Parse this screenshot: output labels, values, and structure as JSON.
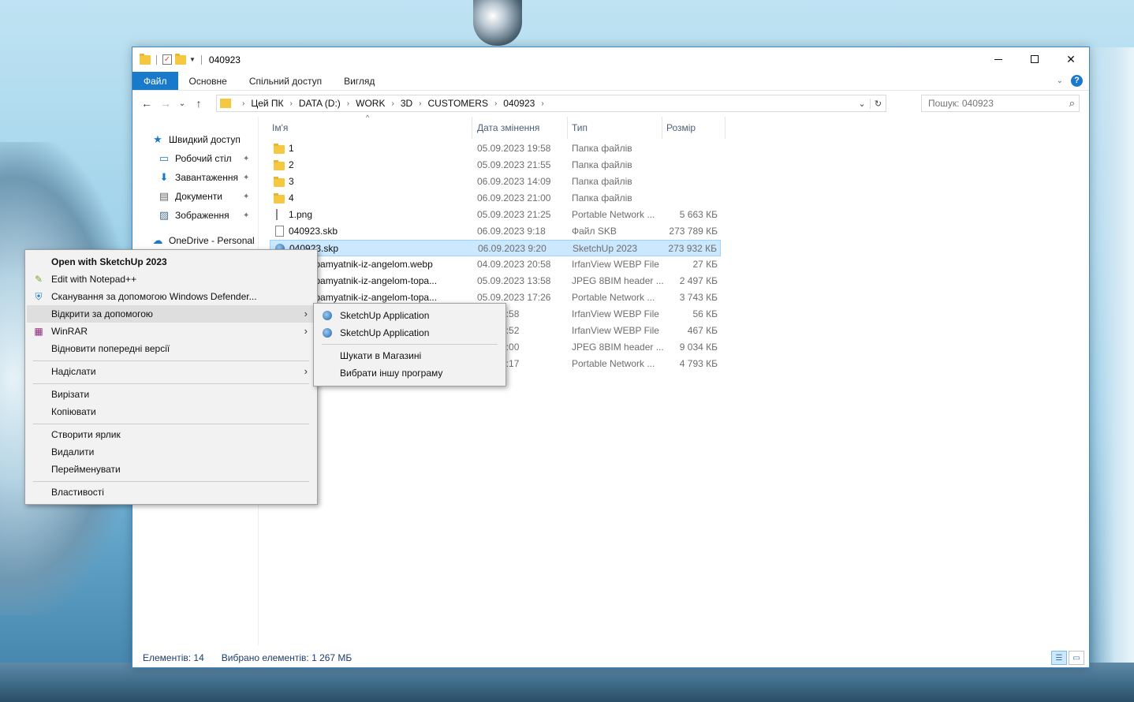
{
  "window": {
    "title": "040923",
    "qat_separator": "|",
    "controls": {
      "minimize": "–",
      "maximize": "☐",
      "close": "✕"
    }
  },
  "ribbon": {
    "tabs": [
      "Файл",
      "Основне",
      "Спільний доступ",
      "Вигляд"
    ],
    "expand_glyph": "⌄",
    "help_glyph": "?"
  },
  "nav": {
    "back": "←",
    "forward": "→",
    "recent": "⌄",
    "up": "↑"
  },
  "address": {
    "crumbs": [
      "Цей ПК",
      "DATA (D:)",
      "WORK",
      "3D",
      "CUSTOMERS",
      "040923"
    ],
    "separator": "›",
    "dropdown_glyph": "⌄",
    "refresh_glyph": "↻"
  },
  "search": {
    "placeholder": "Пошук: 040923",
    "icon_glyph": "⌕"
  },
  "navpane": {
    "items": [
      {
        "label": "Швидкий доступ",
        "icon": "star-icon",
        "glyph": "★",
        "color": "#1979ca"
      },
      {
        "label": "Робочий стіл",
        "icon": "desktop-icon",
        "glyph": "▭",
        "color": "#1979ca",
        "pinned": true
      },
      {
        "label": "Завантаження",
        "icon": "download-icon",
        "glyph": "⬇",
        "color": "#1979ca",
        "pinned": true
      },
      {
        "label": "Документи",
        "icon": "documents-icon",
        "glyph": "▤",
        "color": "#666666",
        "pinned": true
      },
      {
        "label": "Зображення",
        "icon": "pictures-icon",
        "glyph": "▨",
        "color": "#4a6d8c",
        "pinned": true
      },
      {
        "label": "OneDrive - Personal",
        "icon": "onedrive-icon",
        "glyph": "☁",
        "color": "#1979ca"
      }
    ],
    "pin_glyph": "📌"
  },
  "columns": {
    "name": "Ім'я",
    "date": "Дата змінення",
    "type": "Тип",
    "size": "Розмір",
    "sort_glyph": "^"
  },
  "files": [
    {
      "name": "1",
      "date": "05.09.2023 19:58",
      "type": "Папка файлів",
      "size": "",
      "icon": "folder"
    },
    {
      "name": "2",
      "date": "05.09.2023 21:55",
      "type": "Папка файлів",
      "size": "",
      "icon": "folder"
    },
    {
      "name": "3",
      "date": "06.09.2023 14:09",
      "type": "Папка файлів",
      "size": "",
      "icon": "folder"
    },
    {
      "name": "4",
      "date": "06.09.2023 21:00",
      "type": "Папка файлів",
      "size": "",
      "icon": "folder"
    },
    {
      "name": "1.png",
      "date": "05.09.2023 21:25",
      "type": "Portable Network ...",
      "size": "5 663 КБ",
      "icon": "png"
    },
    {
      "name": "040923.skb",
      "date": "06.09.2023 9:18",
      "type": "Файл SKB",
      "size": "273 789 КБ",
      "icon": "file"
    },
    {
      "name": "040923.skp",
      "date": "06.09.2023 9:20",
      "type": "SketchUp 2023",
      "size": "273 932 КБ",
      "icon": "skp",
      "selected": true
    },
    {
      "name": "5171_pamyatnik-iz-angelom.webp",
      "date": "04.09.2023 20:58",
      "type": "IrfanView WEBP File",
      "size": "27 КБ",
      "icon": "file"
    },
    {
      "name": "5171_pamyatnik-iz-angelom-topa...",
      "date": "05.09.2023 13:58",
      "type": "JPEG 8BIM header ...",
      "size": "2 497 КБ",
      "icon": "file"
    },
    {
      "name": "5171_pamyatnik-iz-angelom-topa...",
      "date": "05.09.2023 17:26",
      "type": "Portable Network ...",
      "size": "3 743 КБ",
      "icon": "file"
    },
    {
      "name": "",
      "date": "023 20:58",
      "type": "IrfanView WEBP File",
      "size": "56 КБ",
      "icon": "none"
    },
    {
      "name": "",
      "date": "023 13:52",
      "type": "IrfanView WEBP File",
      "size": "467 КБ",
      "icon": "none"
    },
    {
      "name": "",
      "date": "023 14:00",
      "type": "JPEG 8BIM header ...",
      "size": "9 034 КБ",
      "icon": "none"
    },
    {
      "name": "",
      "date": "023 17:17",
      "type": "Portable Network ...",
      "size": "4 793 КБ",
      "icon": "none"
    }
  ],
  "status": {
    "count": "Елементів: 14",
    "selected": "Вибрано елементів: 1  267 МБ"
  },
  "context_menu": {
    "items": [
      {
        "label": "Open with SketchUp 2023",
        "bold": true
      },
      {
        "label": "Edit with Notepad++",
        "icon": "notepadpp-icon",
        "glyph": "✎"
      },
      {
        "label": "Сканування за допомогою Windows Defender...",
        "icon": "defender-icon",
        "glyph": "⛨"
      },
      {
        "label": "Відкрити за допомогою",
        "submenu": true,
        "hover": true
      },
      {
        "label": "WinRAR",
        "icon": "winrar-icon",
        "glyph": "▦",
        "submenu": true
      },
      {
        "label": "Відновити попередні версії"
      },
      {
        "label": "Надіслати",
        "submenu": true
      },
      {
        "label": "Вирізати"
      },
      {
        "label": "Копіювати"
      },
      {
        "label": "Створити ярлик"
      },
      {
        "label": "Видалити"
      },
      {
        "label": "Перейменувати"
      },
      {
        "label": "Властивості"
      }
    ],
    "submenu_glyph": "›"
  },
  "open_with_submenu": {
    "items": [
      {
        "label": "SketchUp Application",
        "icon": "sketchup-icon"
      },
      {
        "label": "SketchUp Application",
        "icon": "sketchup-icon"
      },
      {
        "label": "Шукати в Магазині"
      },
      {
        "label": "Вибрати іншу програму"
      }
    ]
  },
  "colors": {
    "accent": "#1979ca",
    "selection": "#cce8ff",
    "selection_border": "#99d1ff",
    "menu_bg": "#f2f2f2"
  }
}
